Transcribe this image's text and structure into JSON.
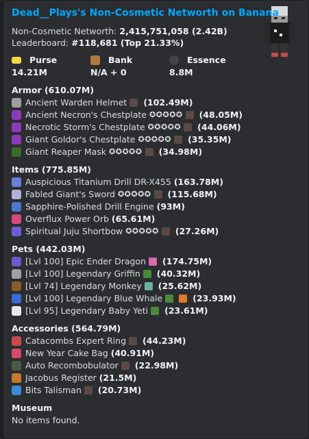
{
  "title": "Dead__Plays's Non-Cosmetic Networth on Banana",
  "summary": {
    "networth_label": "Non-Cosmetic Networth:",
    "networth_value": "2,415,751,058 (2.42B)",
    "leaderboard_label": "Leaderboard:",
    "leaderboard_value": "#118,681 (Top 21.33%)"
  },
  "fields": [
    {
      "name": "Purse",
      "value": "14.21M",
      "icon": "purse-icon",
      "color": "#f5d742"
    },
    {
      "name": "Bank",
      "value": "N/A + 0",
      "icon": "bank-icon",
      "color": "#b07a3e"
    },
    {
      "name": "Essence",
      "value": "8.8M",
      "icon": "essence-icon",
      "color": "#444444"
    }
  ],
  "sections": [
    {
      "title": "Armor (610.07M)",
      "items": [
        {
          "icon": "helmet-icon",
          "color": "#9e9e9e",
          "name": "Ancient Warden Helmet",
          "stars": "",
          "extras": [
            "#5a4a45"
          ],
          "value": "(102.49M)"
        },
        {
          "icon": "chestplate-icon",
          "color": "#8e3ab8",
          "name": "Ancient Necron's Chestplate",
          "stars": "✪✪✪✪✪",
          "extras": [
            "#5a4a45"
          ],
          "value": "(48.05M)"
        },
        {
          "icon": "chestplate-icon",
          "color": "#8e3ab8",
          "name": "Necrotic Storm's Chestplate",
          "stars": "✪✪✪✪✪",
          "extras": [
            "#5a4a45"
          ],
          "value": "(44.06M)"
        },
        {
          "icon": "chestplate-icon",
          "color": "#8e3ab8",
          "name": "Giant Goldor's Chestplate",
          "stars": "✪✪✪✪✪",
          "extras": [
            "#5a4a45"
          ],
          "value": "(35.35M)"
        },
        {
          "icon": "mask-icon",
          "color": "#3b6b2f",
          "name": "Giant Reaper Mask",
          "stars": "✪✪✪✪✪",
          "extras": [
            "#5a4a45"
          ],
          "value": "(34.98M)"
        }
      ]
    },
    {
      "title": "Items (775.85M)",
      "items": [
        {
          "icon": "drill-icon",
          "color": "#6a7fd8",
          "name": "Auspicious Titanium Drill DR-X455",
          "stars": "",
          "extras": [],
          "value": "(163.78M)"
        },
        {
          "icon": "sword-icon",
          "color": "#b0b0d8",
          "name": "Fabled Giant's Sword",
          "stars": "✪✪✪✪✪",
          "extras": [
            "#5a4a45"
          ],
          "value": "(115.68M)"
        },
        {
          "icon": "engine-icon",
          "color": "#4a78c8",
          "name": "Sapphire-Polished Drill Engine",
          "stars": "",
          "extras": [],
          "value": "(93M)"
        },
        {
          "icon": "orb-icon",
          "color": "#d64a7a",
          "name": "Overflux Power Orb",
          "stars": "",
          "extras": [],
          "value": "(65.61M)"
        },
        {
          "icon": "bow-icon",
          "color": "#6b5fd8",
          "name": "Spiritual Juju Shortbow",
          "stars": "✪✪✪✪✪",
          "extras": [
            "#5a4a45"
          ],
          "value": "(27.26M)"
        }
      ]
    },
    {
      "title": "Pets (442.03M)",
      "items": [
        {
          "icon": "pet-icon",
          "color": "#6a5acd",
          "name": "[Lvl 100] Epic Ender Dragon",
          "stars": "",
          "extras": [
            "#d86aa8"
          ],
          "value": "(174.75M)"
        },
        {
          "icon": "pet-icon",
          "color": "#a0a0a0",
          "name": "[Lvl 100] Legendary Griffin",
          "stars": "",
          "extras": [
            "#4a8a3a"
          ],
          "value": "(40.32M)"
        },
        {
          "icon": "pet-icon",
          "color": "#8a5a2a",
          "name": "[Lvl 74] Legendary Monkey",
          "stars": "",
          "extras": [
            "#6ab0a0"
          ],
          "value": "(25.62M)"
        },
        {
          "icon": "pet-icon",
          "color": "#3a6ad8",
          "name": "[Lvl 100] Legendary Blue Whale",
          "stars": "",
          "extras": [
            "#4a8a3a",
            "#e07a2a"
          ],
          "value": "(23.93M)"
        },
        {
          "icon": "pet-icon",
          "color": "#e8e8e8",
          "name": "[Lvl 95] Legendary Baby Yeti",
          "stars": "",
          "extras": [
            "#4a8a3a"
          ],
          "value": "(23.61M)"
        }
      ]
    },
    {
      "title": "Accessories (564.79M)",
      "items": [
        {
          "icon": "ring-icon",
          "color": "#c84a4a",
          "name": "Catacombs Expert Ring",
          "stars": "",
          "extras": [
            "#5a4a45"
          ],
          "value": "(44.23M)"
        },
        {
          "icon": "cake-icon",
          "color": "#d84a6a",
          "name": "New Year Cake Bag",
          "stars": "",
          "extras": [],
          "value": "(40.91M)"
        },
        {
          "icon": "recombobulator-icon",
          "color": "#4a5a4a",
          "name": "Auto Recombobulator",
          "stars": "",
          "extras": [
            "#5a4a45"
          ],
          "value": "(22.98M)"
        },
        {
          "icon": "register-icon",
          "color": "#c87a2a",
          "name": "Jacobus Register",
          "stars": "",
          "extras": [],
          "value": "(21.5M)"
        },
        {
          "icon": "talisman-icon",
          "color": "#3a8ad8",
          "name": "Bits Talisman",
          "stars": "",
          "extras": [
            "#5a4a45"
          ],
          "value": "(20.73M)"
        }
      ]
    },
    {
      "title": "Museum",
      "empty_text": "No items found.",
      "items": []
    }
  ]
}
